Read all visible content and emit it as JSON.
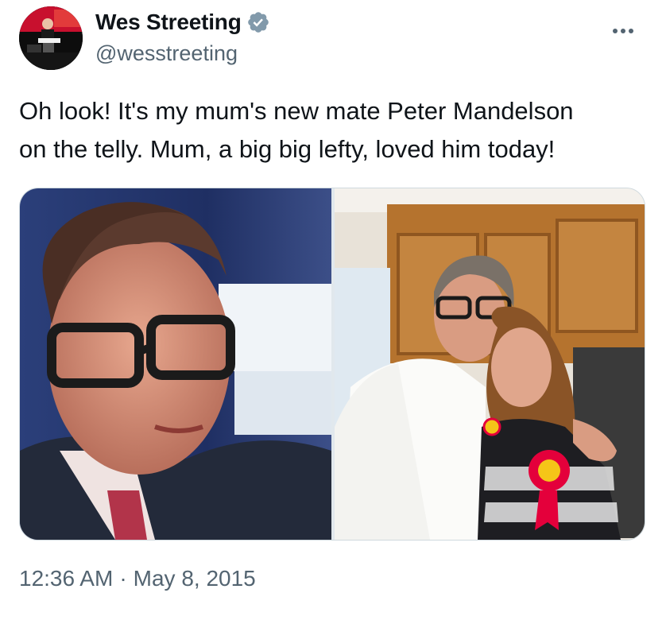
{
  "tweet": {
    "author": {
      "display_name": "Wes Streeting",
      "handle": "@wesstreeting",
      "verified": true,
      "avatar_icon": "avatar-photo"
    },
    "text_lines": [
      "Oh look! It's my mum's new mate Peter Mandelson",
      "on the telly. Mum, a big big lefty, loved him today!"
    ],
    "media": [
      {
        "description_icon": "photo-man-glasses-on-tv"
      },
      {
        "description_icon": "photo-man-and-woman-kitchen"
      }
    ],
    "time": "12:36 AM",
    "separator": "·",
    "date": "May 8, 2015"
  },
  "colors": {
    "text_primary": "#0f1419",
    "text_secondary": "#536471",
    "verified_badge": "#829aab",
    "border": "#cfd9de",
    "labour_red": "#e4003b"
  }
}
